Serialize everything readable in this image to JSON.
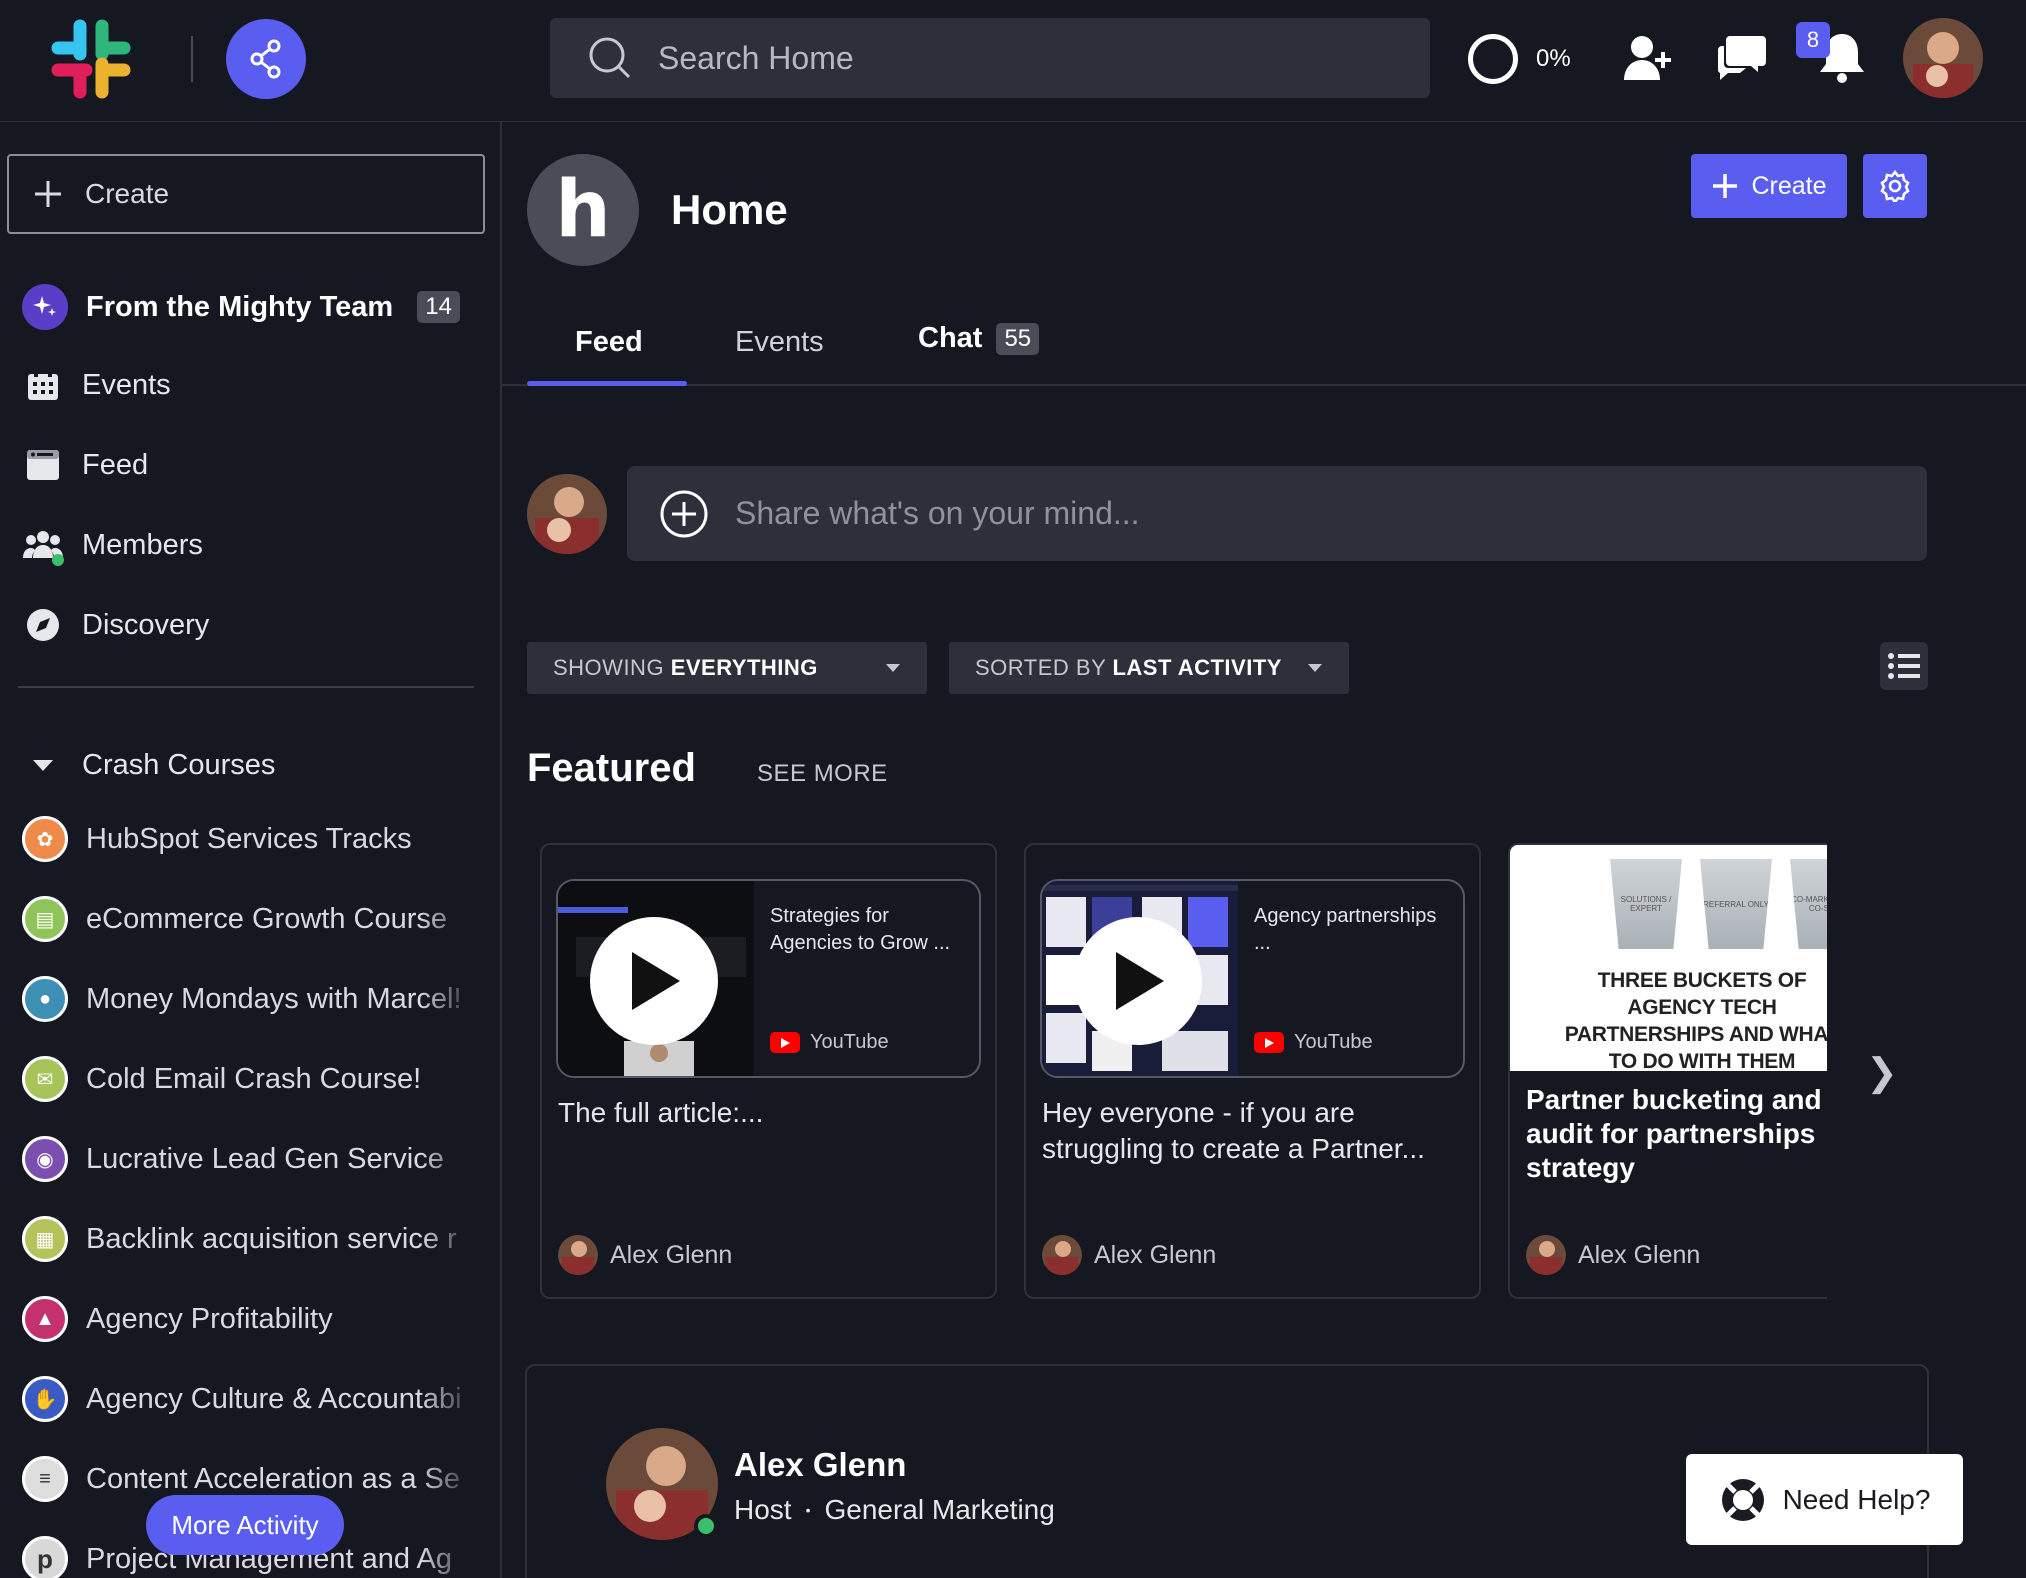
{
  "header": {
    "search_placeholder": "Search Home",
    "progress_text": "0%",
    "notification_count": "8"
  },
  "sidebar": {
    "create_label": "Create",
    "nav": [
      {
        "label": "From the Mighty Team",
        "count": "14",
        "icon": "sparkle-icon"
      },
      {
        "label": "Events",
        "icon": "calendar-icon"
      },
      {
        "label": "Feed",
        "icon": "feed-icon"
      },
      {
        "label": "Members",
        "icon": "members-icon"
      },
      {
        "label": "Discovery",
        "icon": "compass-icon"
      }
    ],
    "section_label": "Crash Courses",
    "courses": [
      {
        "label": "HubSpot Services Tracks",
        "color": "#f08a4b"
      },
      {
        "label": "eCommerce Growth Course",
        "color": "#8fc45a"
      },
      {
        "label": "Money Mondays with Marcel!",
        "color": "#3d8fb5"
      },
      {
        "label": "Cold Email Crash Course!",
        "color": "#a6c45a"
      },
      {
        "label": "Lucrative Lead Gen Service",
        "color": "#7b4fb0"
      },
      {
        "label": "Backlink acquisition service r",
        "color": "#b5c45a"
      },
      {
        "label": "Agency Profitability",
        "color": "#c4326e"
      },
      {
        "label": "Agency Culture & Accountabi",
        "color": "#3a5ac4"
      },
      {
        "label": "Content Acceleration as a Se",
        "color": "#dddddd"
      },
      {
        "label": "Project Management and Ag",
        "color": "#d8d8d8"
      }
    ],
    "more_activity": "More Activity"
  },
  "main": {
    "title": "Home",
    "avatar_letter": "h",
    "create_label": "Create",
    "tabs": [
      {
        "label": "Feed",
        "active": true
      },
      {
        "label": "Events"
      },
      {
        "label": "Chat",
        "count": "55"
      }
    ],
    "composer_placeholder": "Share what's on your mind...",
    "filter_showing_prefix": "SHOWING",
    "filter_showing_value": "EVERYTHING",
    "filter_sorted_prefix": "SORTED BY",
    "filter_sorted_value": "LAST ACTIVITY",
    "featured_heading": "Featured",
    "see_more": "SEE MORE",
    "featured": [
      {
        "embed_title": "Strategies for Agencies to Grow ...",
        "source": "YouTube",
        "text": "The full article:...",
        "author": "Alex Glenn"
      },
      {
        "embed_title": "Agency partnerships ...",
        "source": "YouTube",
        "text": "Hey everyone - if you are struggling to create a Partner...",
        "author": "Alex Glenn"
      },
      {
        "art_title": "THREE BUCKETS OF AGENCY TECH PARTNERSHIPS AND WHAT TO DO WITH THEM",
        "buckets": [
          "SOLUTIONS / EXPERT",
          "REFERRAL ONLY",
          "CO-MARKETING & CO-SELL"
        ],
        "text": "Partner bucketing and audit for partnerships strategy",
        "author": "Alex Glenn"
      }
    ],
    "post": {
      "author": "Alex Glenn",
      "role": "Host",
      "space": "General Marketing"
    },
    "help_label": "Need Help?"
  },
  "colors": {
    "accent": "#5a5ef0",
    "background": "#161821",
    "surface": "#2d303a"
  }
}
